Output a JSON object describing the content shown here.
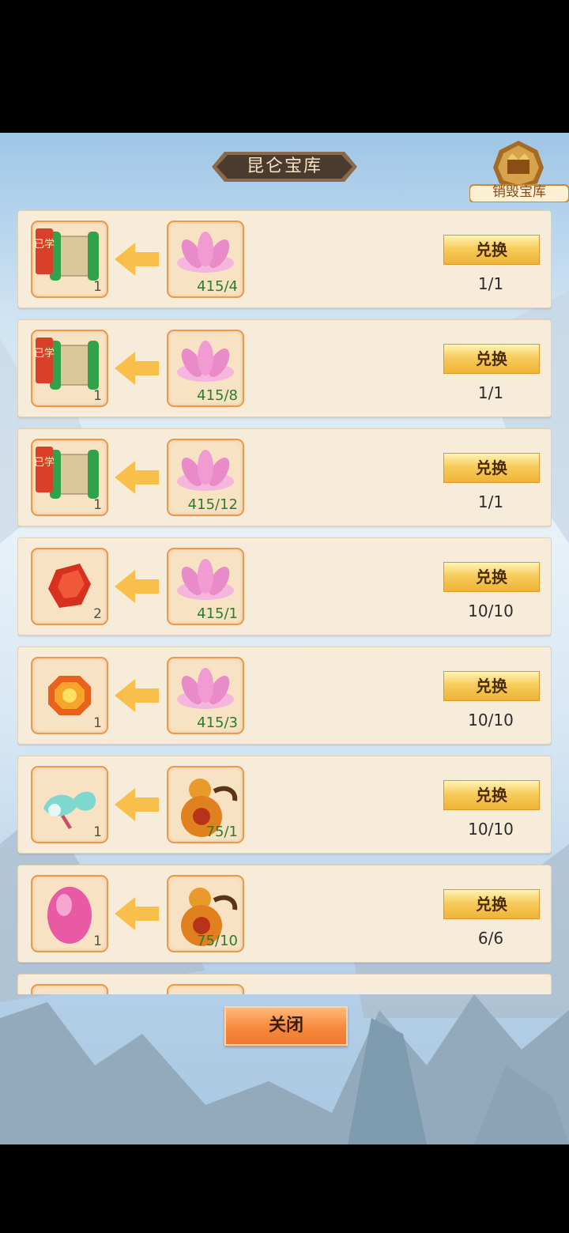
{
  "title": "昆仑宝库",
  "destroy_label": "销毁宝库",
  "close_label": "关闭",
  "rows": [
    {
      "reward_icon": "scroll-icon",
      "reward_tag": "已学",
      "reward_count": "1",
      "cost_icon": "lotus-icon",
      "cost": "415/4",
      "button": "兑换",
      "limit": "1/1"
    },
    {
      "reward_icon": "scroll-icon",
      "reward_tag": "已学",
      "reward_count": "1",
      "cost_icon": "lotus-icon",
      "cost": "415/8",
      "button": "兑换",
      "limit": "1/1"
    },
    {
      "reward_icon": "scroll-icon",
      "reward_tag": "已学",
      "reward_count": "1",
      "cost_icon": "lotus-icon",
      "cost": "415/12",
      "button": "兑换",
      "limit": "1/1"
    },
    {
      "reward_icon": "red-gem-icon",
      "reward_count": "2",
      "cost_icon": "lotus-icon",
      "cost": "415/1",
      "button": "兑换",
      "limit": "10/10"
    },
    {
      "reward_icon": "orange-gem-icon",
      "reward_count": "1",
      "cost_icon": "lotus-icon",
      "cost": "415/3",
      "button": "兑换",
      "limit": "10/10"
    },
    {
      "reward_icon": "cloud-ribbon-icon",
      "reward_count": "1",
      "cost_icon": "gourd-icon",
      "cost": "75/1",
      "button": "兑换",
      "limit": "10/10"
    },
    {
      "reward_icon": "pink-egg-icon",
      "reward_count": "1",
      "cost_icon": "gourd-icon",
      "cost": "75/10",
      "button": "兑换",
      "limit": "6/6"
    }
  ],
  "colors": {
    "button": "#f7cc5c",
    "close": "#f7893d",
    "count_green": "#2f7a2f",
    "slot_border": "#e89a4d"
  }
}
